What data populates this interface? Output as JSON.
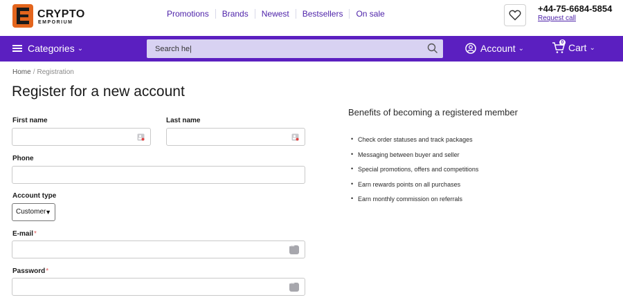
{
  "brand": {
    "name": "CRYPTO",
    "tagline": "EMPORIUM"
  },
  "topnav": [
    "Promotions",
    "Brands",
    "Newest",
    "Bestsellers",
    "On sale"
  ],
  "contact": {
    "phone": "+44-75-6684-5854",
    "request_call": "Request call"
  },
  "navbar": {
    "categories": "Categories",
    "search_value": "Search he|",
    "account": "Account",
    "cart": "Cart",
    "cart_count": "0"
  },
  "breadcrumb": {
    "home": "Home",
    "separator": "/",
    "current": "Registration"
  },
  "page_title": "Register for a new account",
  "form": {
    "first_name": "First name",
    "last_name": "Last name",
    "phone": "Phone",
    "account_type": "Account type",
    "account_type_selected": "Customer",
    "email": "E-mail",
    "password": "Password",
    "required_mark": "*"
  },
  "benefits": {
    "title": "Benefits of becoming a registered member",
    "items": [
      "Check order statuses and track packages",
      "Messaging between buyer and seller",
      "Special promotions, offers and competitions",
      "Earn rewards points on all purchases",
      "Earn monthly commission on referrals"
    ]
  },
  "colors": {
    "accent": "#5b1fc0",
    "link": "#4b1fa8",
    "logo": "#e3651d"
  }
}
